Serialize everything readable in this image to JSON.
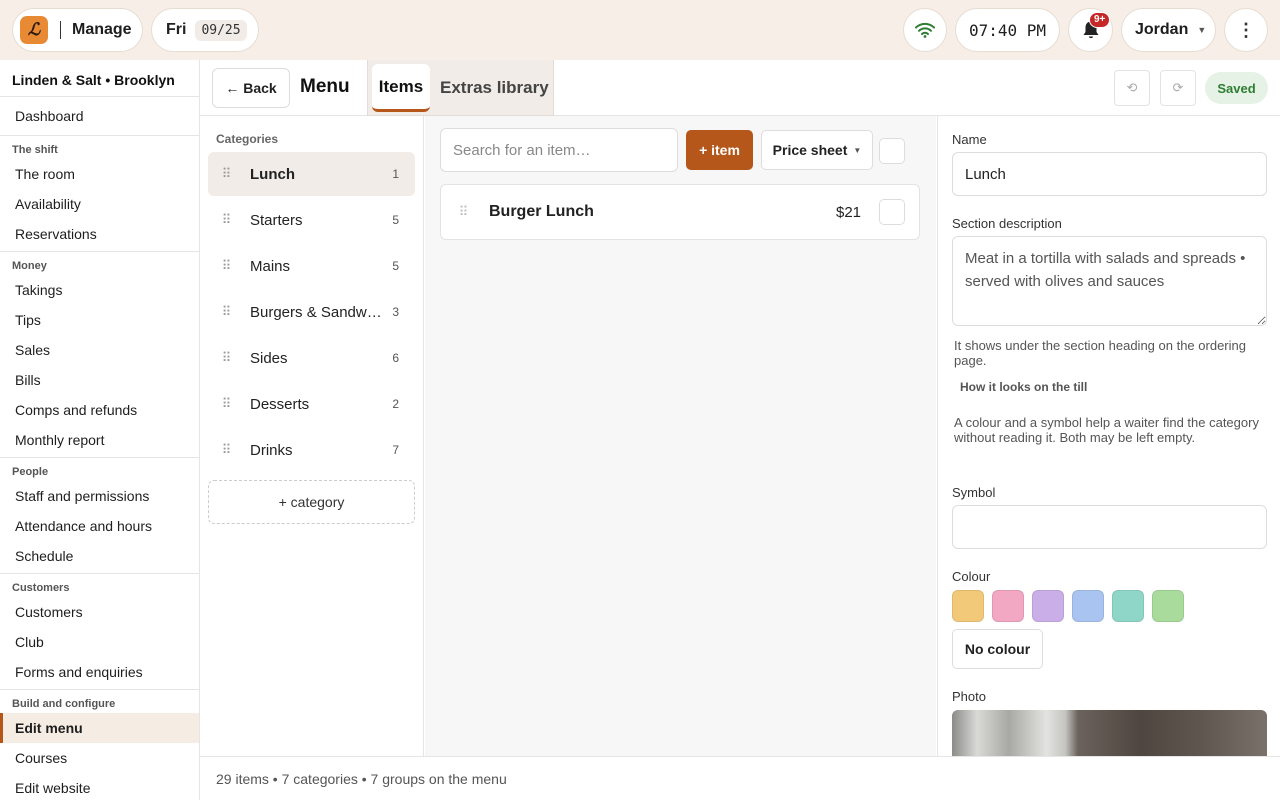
{
  "topbar": {
    "logo_glyph": "ℒ",
    "app_title": "Manage",
    "day": "Fri",
    "date": "09/25",
    "time": "07:40 PM",
    "notifications_badge": "9+",
    "user_name": "Jordan"
  },
  "sidebar": {
    "venue": "Linden & Salt • Brooklyn",
    "dashboard": "Dashboard",
    "groups": [
      {
        "heading": "The shift",
        "items": [
          "The room",
          "Availability",
          "Reservations"
        ]
      },
      {
        "heading": "Money",
        "items": [
          "Takings",
          "Tips",
          "Sales",
          "Bills",
          "Comps and refunds",
          "Monthly report"
        ]
      },
      {
        "heading": "People",
        "items": [
          "Staff and permissions",
          "Attendance and hours",
          "Schedule"
        ]
      },
      {
        "heading": "Customers",
        "items": [
          "Customers",
          "Club",
          "Forms and enquiries"
        ]
      },
      {
        "heading": "Build and configure",
        "items": [
          "Edit menu",
          "Courses",
          "Edit website"
        ]
      }
    ],
    "active_item": "Edit menu"
  },
  "header": {
    "back_label": "← Back",
    "title": "Menu",
    "tabs": [
      {
        "label": "Items",
        "active": true
      },
      {
        "label": "Extras library",
        "active": false
      }
    ],
    "undo_glyph": "⟲",
    "redo_glyph": "⟳",
    "status": "Saved"
  },
  "categories": {
    "heading": "Categories",
    "grip_glyph": "⠿",
    "items": [
      {
        "name": "Lunch",
        "count": "1",
        "selected": true
      },
      {
        "name": "Starters",
        "count": "5",
        "selected": false
      },
      {
        "name": "Mains",
        "count": "5",
        "selected": false
      },
      {
        "name": "Burgers & Sandwiches",
        "count": "3",
        "selected": false
      },
      {
        "name": "Sides",
        "count": "6",
        "selected": false
      },
      {
        "name": "Desserts",
        "count": "2",
        "selected": false
      },
      {
        "name": "Drinks",
        "count": "7",
        "selected": false
      }
    ],
    "add_label": "+ category"
  },
  "items_panel": {
    "search_placeholder": "Search for an item…",
    "add_label": "+ item",
    "price_sheet_label": "Price sheet",
    "items": [
      {
        "name": "Burger Lunch",
        "price": "$21"
      }
    ]
  },
  "detail": {
    "name_label": "Name",
    "name_value": "Lunch",
    "description_label": "Section description",
    "description_value": "Meat in a tortilla with salads and spreads • served with olives and sauces",
    "description_help": "It shows under the section heading on the ordering page.",
    "till_label": "How it looks on the till",
    "till_help": "A colour and a symbol help a waiter find the category without reading it. Both may be left empty.",
    "symbol_label": "Symbol",
    "symbol_value": "",
    "colour_label": "Colour",
    "colours": [
      "#f2c879",
      "#f2a7c3",
      "#c9aee8",
      "#a9c4f0",
      "#8fd6c8",
      "#a9dc9c"
    ],
    "no_colour_label": "No colour",
    "photo_label": "Photo"
  },
  "footer": {
    "summary": "29 items • 7 categories • 7 groups on the menu"
  }
}
